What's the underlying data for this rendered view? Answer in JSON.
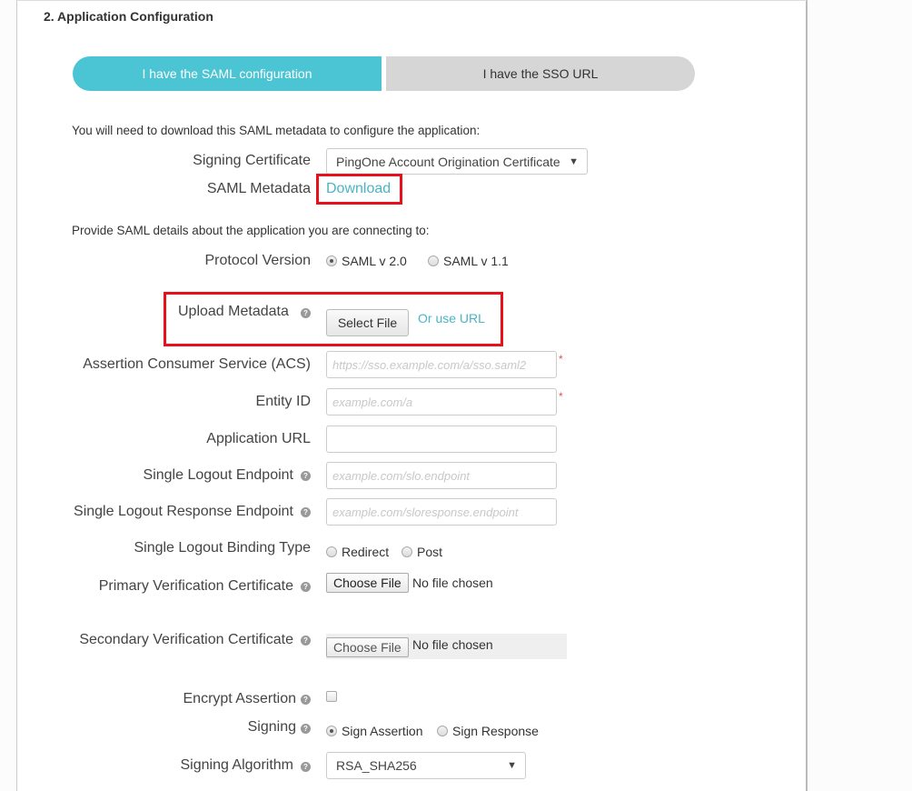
{
  "section": {
    "title": "2. Application Configuration"
  },
  "config_toggle": {
    "options": [
      {
        "label": "I have the SAML configuration",
        "active": true
      },
      {
        "label": "I have the SSO URL",
        "active": false
      }
    ]
  },
  "metadata_download": {
    "intro": "You will need to download this SAML metadata to configure the application:",
    "signing_certificate": {
      "label": "Signing Certificate",
      "selected": "PingOne Account Origination Certificate"
    },
    "saml_metadata": {
      "label": "SAML Metadata",
      "link": "Download"
    }
  },
  "saml_details": {
    "intro": "Provide SAML details about the application you are connecting to:",
    "protocol_version": {
      "label": "Protocol Version",
      "options": [
        {
          "label": "SAML v 2.0",
          "checked": true
        },
        {
          "label": "SAML v 1.1",
          "checked": false
        }
      ]
    },
    "upload_metadata": {
      "label": "Upload Metadata",
      "button": "Select File",
      "link": "Or use URL"
    },
    "acs": {
      "label": "Assertion Consumer Service (ACS)",
      "value": "",
      "placeholder": "https://sso.example.com/a/sso.saml2",
      "required_mark": "*"
    },
    "entity_id": {
      "label": "Entity ID",
      "value": "",
      "placeholder": "example.com/a",
      "required_mark": "*"
    },
    "application_url": {
      "label": "Application URL",
      "value": "",
      "placeholder": ""
    },
    "slo_endpoint": {
      "label": "Single Logout Endpoint",
      "value": "",
      "placeholder": "example.com/slo.endpoint"
    },
    "slo_response_endpoint": {
      "label": "Single Logout Response Endpoint",
      "value": "",
      "placeholder": "example.com/sloresponse.endpoint"
    },
    "slo_binding_type": {
      "label": "Single Logout Binding Type",
      "options": [
        {
          "label": "Redirect",
          "checked": false
        },
        {
          "label": "Post",
          "checked": false
        }
      ]
    },
    "primary_cert": {
      "label": "Primary Verification Certificate",
      "button": "Choose File",
      "status": "No file chosen"
    },
    "secondary_cert": {
      "label": "Secondary Verification Certificate",
      "button": "Choose File",
      "status": "No file chosen"
    },
    "encrypt_assertion": {
      "label": "Encrypt Assertion",
      "checked": false
    },
    "signing": {
      "label": "Signing",
      "options": [
        {
          "label": "Sign Assertion",
          "checked": true
        },
        {
          "label": "Sign Response",
          "checked": false
        }
      ]
    },
    "signing_algorithm": {
      "label": "Signing Algorithm",
      "selected": "RSA_SHA256"
    }
  },
  "icons": {
    "help": "?",
    "dropdown": "▼"
  }
}
